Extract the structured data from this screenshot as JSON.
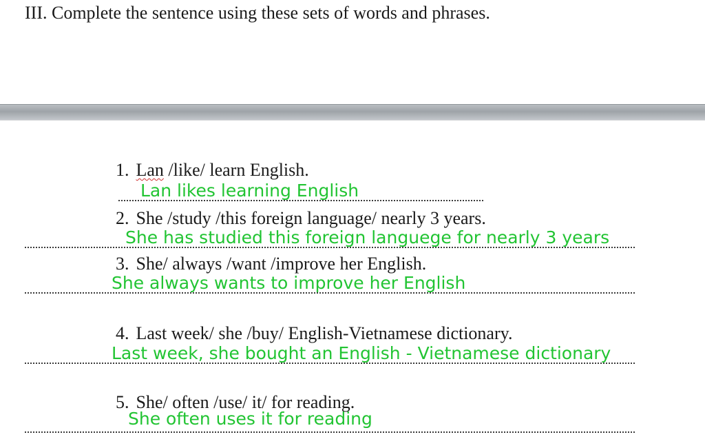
{
  "heading": "III. Complete the sentence using these sets of words and phrases.",
  "items": [
    {
      "number": "1.",
      "prompt_first_word": "Lan",
      "prompt_rest": " /like/ learn English.",
      "answer": "Lan likes learning English"
    },
    {
      "number": "2.",
      "prompt": "She /study /this foreign language/ nearly 3 years.",
      "answer": "She has studied this foreign languege for nearly 3 years"
    },
    {
      "number": "3.",
      "prompt": "She/ always /want /improve her English.",
      "answer": "She always wants to improve her English"
    },
    {
      "number": "4.",
      "prompt": "Last week/ she /buy/ English-Vietnamese dictionary.",
      "answer": "Last week, she bought an English - Vietnamese dictionary"
    },
    {
      "number": "5.",
      "prompt": "She/ often /use/ it/ for reading.",
      "answer": "She often uses it for reading"
    }
  ]
}
